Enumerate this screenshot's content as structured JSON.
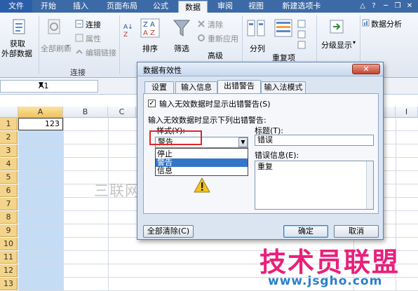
{
  "ribbon_tabs": [
    "文件",
    "开始",
    "插入",
    "页面布局",
    "公式",
    "数据",
    "审阅",
    "视图",
    "新建选项卡"
  ],
  "active_tab": "数据",
  "window_controls": [
    "△",
    "?",
    "─",
    "❐",
    "✕"
  ],
  "ribbon": {
    "get_external": "获取",
    "get_external2": "外部数据",
    "refresh_all": "全部刷新",
    "connections": "连接",
    "properties": "属性",
    "edit_links": "编辑链接",
    "group_connections": "连接",
    "sort": "排序",
    "filter": "筛选",
    "clear": "清除",
    "reapply": "重新应用",
    "advanced": "高级",
    "split": "分列",
    "dedupe": "重复项",
    "outline": "分级显示",
    "analysis": "数据分析"
  },
  "name_box": "A1",
  "columns": [
    "A",
    "B",
    "C",
    "H",
    "I"
  ],
  "rows": [
    "1",
    "2",
    "3",
    "4",
    "5",
    "6",
    "7",
    "8",
    "9",
    "10",
    "11",
    "12",
    "13"
  ],
  "cell_a1": "123",
  "dialog": {
    "title": "数据有效性",
    "close": "✕",
    "tabs": [
      "设置",
      "输入信息",
      "出错警告",
      "输入法模式"
    ],
    "active_tab": "出错警告",
    "show_alert_label": "输入无效数据时显示出错警告(S)",
    "show_alert_checked": "✓",
    "when_invalid_label": "输入无效数据时显示下列出错警告:",
    "style_label": "样式(Y):",
    "style_value": "警告",
    "style_options": [
      "停止",
      "警告",
      "信息"
    ],
    "highlighted_option": "警告",
    "title_label": "标题(T):",
    "title_value": "错误",
    "error_msg_label": "错误信息(E):",
    "error_msg_value": "重复",
    "clear_all": "全部清除(C)",
    "ok": "确定",
    "cancel": "取消"
  },
  "watermarks": {
    "sanlian": "三联网 3LIAN.COM",
    "brand": "技术员联盟",
    "url": "www.jsgho.com"
  }
}
